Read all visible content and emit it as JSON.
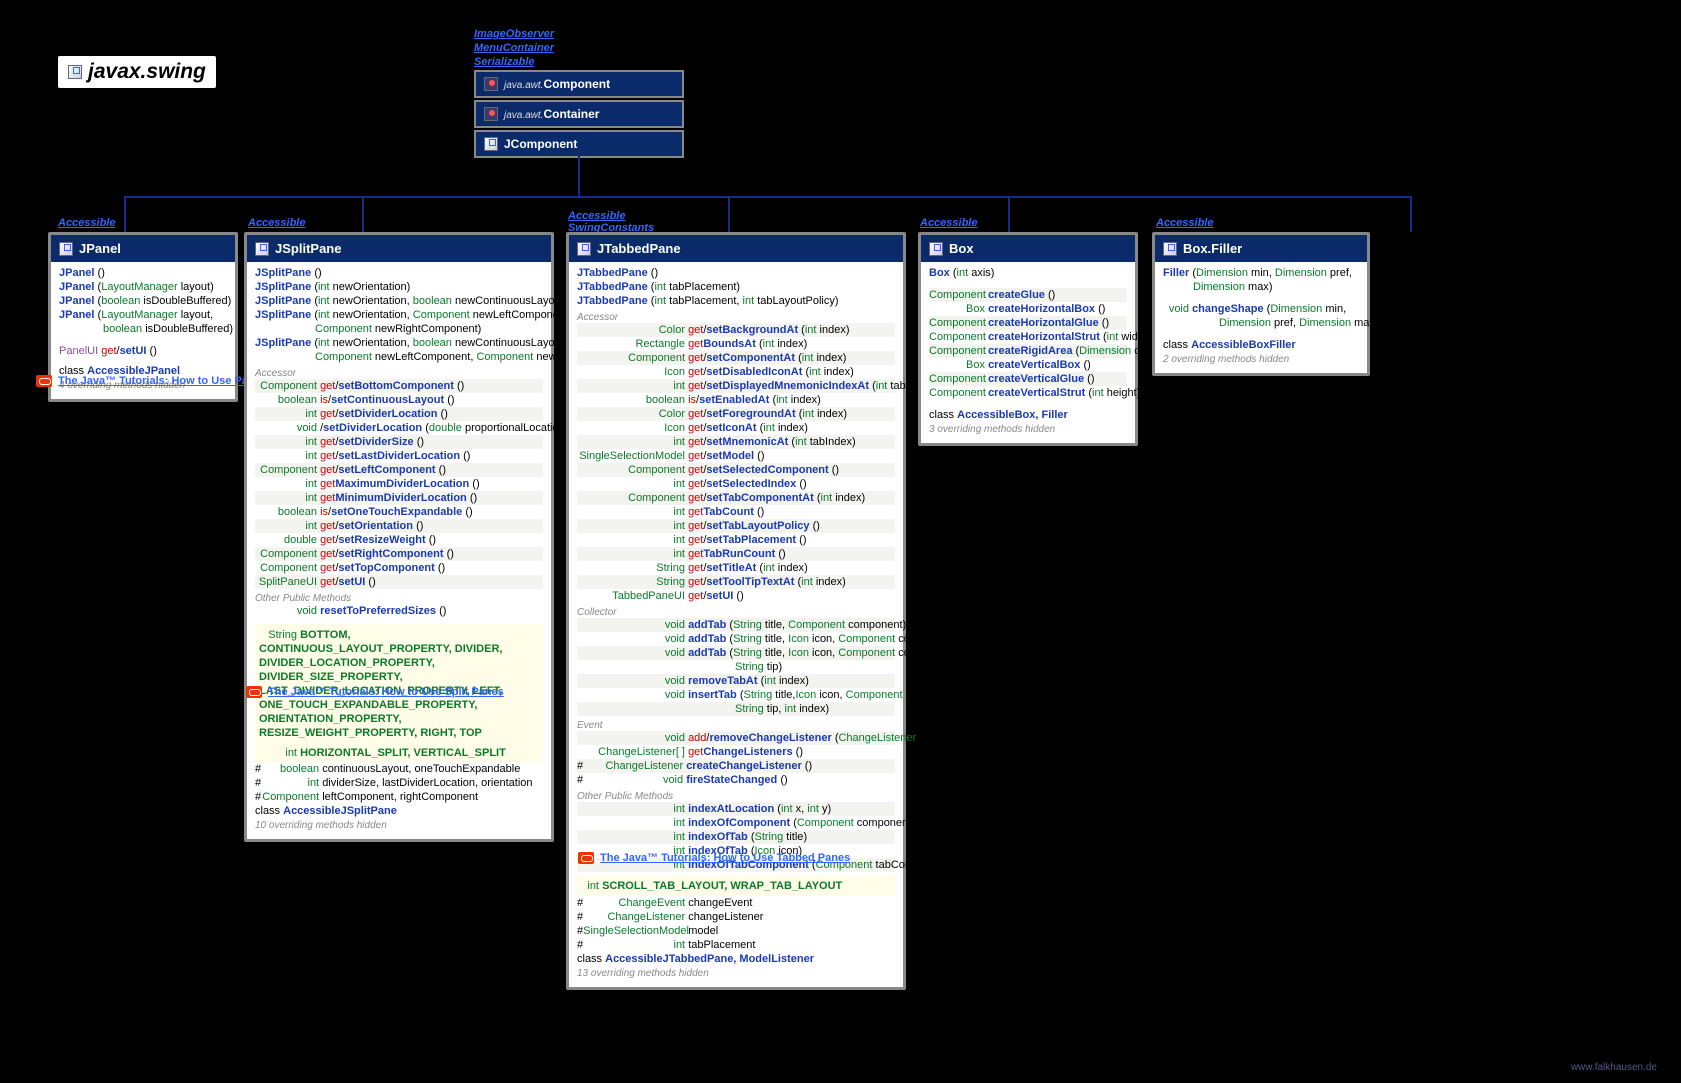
{
  "package": "javax.swing",
  "interfaces_top": [
    "ImageObserver",
    "MenuContainer",
    "Serializable"
  ],
  "roots": [
    {
      "pkg": "java.awt.",
      "name": "Component"
    },
    {
      "pkg": "java.awt.",
      "name": "Container"
    },
    {
      "pkg": "",
      "name": "JComponent"
    }
  ],
  "iface_accessible": "Accessible",
  "iface_swingconstants": "SwingConstants",
  "footer": "www.falkhausen.de",
  "tutorials": {
    "panels": "The Java™ Tutorials: How to Use Panels",
    "splitpanes": "The Java™ Tutorials: How to Use Split Panes",
    "tabbedpanes": "The Java™ Tutorials: How to Use Tabbed Panes"
  },
  "jpanel": {
    "name": "JPanel",
    "ctors": [
      {
        "name": "JPanel",
        "sig": "()"
      },
      {
        "name": "JPanel",
        "sig": "(LayoutManager layout)"
      },
      {
        "name": "JPanel",
        "sig": "(boolean isDoubleBuffered)"
      },
      {
        "name": "JPanel",
        "sig": "(LayoutManager layout,",
        "cont": "boolean isDoubleBuffered)"
      }
    ],
    "ui_ret": "PanelUI",
    "ui_get": "get",
    "ui_set": "setUI",
    "ui_sig": "()",
    "inner_kw": "class",
    "inner": "AccessibleJPanel",
    "hidden": "4 overriding methods hidden"
  },
  "jsplitpane": {
    "name": "JSplitPane",
    "ctors": [
      {
        "name": "JSplitPane",
        "sig": "()"
      },
      {
        "name": "JSplitPane",
        "sig": "(int newOrientation)"
      },
      {
        "name": "JSplitPane",
        "sig": "(int newOrientation, boolean newContinuousLayout)"
      },
      {
        "name": "JSplitPane",
        "sig": "(int newOrientation, Component newLeftComponent,",
        "cont": "Component newRightComponent)"
      },
      {
        "name": "JSplitPane",
        "sig": "(int newOrientation, boolean newContinuousLayout,",
        "cont": "Component newLeftComponent, Component newRightComponent)"
      }
    ],
    "sec_accessor": "Accessor",
    "accessors": [
      {
        "ret": "Component",
        "get": "get",
        "set": "setBottomComponent",
        "sig": "()"
      },
      {
        "ret": "boolean",
        "get": "is",
        "set": "setContinuousLayout",
        "sig": "()"
      },
      {
        "ret": "int",
        "get": "get",
        "set": "setDividerLocation",
        "sig": "()"
      },
      {
        "ret": "void",
        "get": "",
        "set": "setDividerLocation",
        "sig": "(double proportionalLocation)"
      },
      {
        "ret": "int",
        "get": "get",
        "set": "setDividerSize",
        "sig": "()"
      },
      {
        "ret": "int",
        "get": "get",
        "set": "setLastDividerLocation",
        "sig": "()"
      },
      {
        "ret": "Component",
        "get": "get",
        "set": "setLeftComponent",
        "sig": "()"
      },
      {
        "ret": "int",
        "get": "get",
        "set": "MaximumDividerLocation",
        "sig": "()",
        "getonly": true
      },
      {
        "ret": "int",
        "get": "get",
        "set": "MinimumDividerLocation",
        "sig": "()",
        "getonly": true
      },
      {
        "ret": "boolean",
        "get": "is",
        "set": "setOneTouchExpandable",
        "sig": "()"
      },
      {
        "ret": "int",
        "get": "get",
        "set": "setOrientation",
        "sig": "()"
      },
      {
        "ret": "double",
        "get": "get",
        "set": "setResizeWeight",
        "sig": "()"
      },
      {
        "ret": "Component",
        "get": "get",
        "set": "setRightComponent",
        "sig": "()"
      },
      {
        "ret": "Component",
        "get": "get",
        "set": "setTopComponent",
        "sig": "()"
      },
      {
        "ret": "SplitPaneUI",
        "get": "get",
        "set": "setUI",
        "sig": "()"
      }
    ],
    "sec_other": "Other Public Methods",
    "other": [
      {
        "ret": "void",
        "name": "resetToPreferredSizes",
        "sig": "()"
      }
    ],
    "const_ret": "String",
    "const_str": "BOTTOM, CONTINUOUS_LAYOUT_PROPERTY, DIVIDER, DIVIDER_LOCATION_PROPERTY, DIVIDER_SIZE_PROPERTY, LAST_DIVIDER_LOCATION_PROPERTY, LEFT, ONE_TOUCH_EXPANDABLE_PROPERTY, ORIENTATION_PROPERTY, RESIZE_WEIGHT_PROPERTY, RIGHT, TOP",
    "const_int_ret": "int",
    "const_int": "HORIZONTAL_SPLIT, VERTICAL_SPLIT",
    "fields": [
      {
        "mod": "#",
        "ret": "boolean",
        "name": "continuousLayout, oneTouchExpandable"
      },
      {
        "mod": "#",
        "ret": "int",
        "name": "dividerSize, lastDividerLocation, orientation"
      },
      {
        "mod": "#",
        "ret": "Component",
        "name": "leftComponent, rightComponent"
      }
    ],
    "inner_kw": "class",
    "inner": "AccessibleJSplitPane",
    "hidden": "10 overriding methods hidden"
  },
  "jtabbedpane": {
    "name": "JTabbedPane",
    "ctors": [
      {
        "name": "JTabbedPane",
        "sig": "()"
      },
      {
        "name": "JTabbedPane",
        "sig": "(int tabPlacement)"
      },
      {
        "name": "JTabbedPane",
        "sig": "(int tabPlacement, int tabLayoutPolicy)"
      }
    ],
    "sec_accessor": "Accessor",
    "accessors": [
      {
        "ret": "Color",
        "get": "get",
        "set": "setBackgroundAt",
        "sig": "(int index)"
      },
      {
        "ret": "Rectangle",
        "get": "get",
        "set": "BoundsAt",
        "sig": "(int index)",
        "getonly": true
      },
      {
        "ret": "Component",
        "get": "get",
        "set": "setComponentAt",
        "sig": "(int index)"
      },
      {
        "ret": "Icon",
        "get": "get",
        "set": "setDisabledIconAt",
        "sig": "(int index)"
      },
      {
        "ret": "int",
        "get": "get",
        "set": "setDisplayedMnemonicIndexAt",
        "sig": "(int tabIndex)"
      },
      {
        "ret": "boolean",
        "get": "is",
        "set": "setEnabledAt",
        "sig": "(int index)"
      },
      {
        "ret": "Color",
        "get": "get",
        "set": "setForegroundAt",
        "sig": "(int index)"
      },
      {
        "ret": "Icon",
        "get": "get",
        "set": "setIconAt",
        "sig": "(int index)"
      },
      {
        "ret": "int",
        "get": "get",
        "set": "setMnemonicAt",
        "sig": "(int tabIndex)"
      },
      {
        "ret": "SingleSelectionModel",
        "get": "get",
        "set": "setModel",
        "sig": "()"
      },
      {
        "ret": "Component",
        "get": "get",
        "set": "setSelectedComponent",
        "sig": "()"
      },
      {
        "ret": "int",
        "get": "get",
        "set": "setSelectedIndex",
        "sig": "()"
      },
      {
        "ret": "Component",
        "get": "get",
        "set": "setTabComponentAt",
        "sig": "(int index)"
      },
      {
        "ret": "int",
        "get": "get",
        "set": "TabCount",
        "sig": "()",
        "getonly": true
      },
      {
        "ret": "int",
        "get": "get",
        "set": "setTabLayoutPolicy",
        "sig": "()"
      },
      {
        "ret": "int",
        "get": "get",
        "set": "setTabPlacement",
        "sig": "()"
      },
      {
        "ret": "int",
        "get": "get",
        "set": "TabRunCount",
        "sig": "()",
        "getonly": true
      },
      {
        "ret": "String",
        "get": "get",
        "set": "setTitleAt",
        "sig": "(int index)"
      },
      {
        "ret": "String",
        "get": "get",
        "set": "setToolTipTextAt",
        "sig": "(int index)"
      },
      {
        "ret": "TabbedPaneUI",
        "get": "get",
        "set": "setUI",
        "sig": "()"
      }
    ],
    "sec_collector": "Collector",
    "collector": [
      {
        "ret": "void",
        "name": "addTab",
        "sig_html": "(<span class='kw-param'>String</span> title, <span class='kw-param'>Component</span> component)"
      },
      {
        "ret": "void",
        "name": "addTab",
        "sig_html": "(<span class='kw-param'>String</span> title, <span class='kw-param'>Icon</span> icon, <span class='kw-param'>Component</span> component)"
      },
      {
        "ret": "void",
        "name": "addTab",
        "sig_html": "(<span class='kw-param'>String</span> title, <span class='kw-param'>Icon</span> icon, <span class='kw-param'>Component</span> component,",
        "cont": "String tip)"
      },
      {
        "ret": "void",
        "name": "removeTabAt",
        "sig_html": "(<span class='kw-param'>int</span> index)"
      },
      {
        "ret": "void",
        "name": "insertTab",
        "sig_html": "(<span class='kw-param'>String</span> title,<span class='kw-param'>Icon</span> icon, <span class='kw-param'>Component</span> component,",
        "cont": "String tip, int index)"
      }
    ],
    "sec_event": "Event",
    "event": [
      {
        "ret": "void",
        "get": "add",
        "set": "removeChangeListener",
        "sig": "(ChangeListener l)"
      },
      {
        "ret": "ChangeListener[ ]",
        "name": "getChangeListeners",
        "sig": "()",
        "getlike": true
      },
      {
        "mod": "#",
        "ret": "ChangeListener",
        "name": "createChangeListener",
        "sig": "()"
      },
      {
        "mod": "#",
        "ret": "void",
        "name": "fireStateChanged",
        "sig": "()"
      }
    ],
    "sec_other": "Other Public Methods",
    "other": [
      {
        "ret": "int",
        "name": "indexAtLocation",
        "sig": "(int x, int y)"
      },
      {
        "ret": "int",
        "name": "indexOfComponent",
        "sig": "(Component component)"
      },
      {
        "ret": "int",
        "name": "indexOfTab",
        "sig": "(String title)"
      },
      {
        "ret": "int",
        "name": "indexOfTab",
        "sig": "(Icon icon)"
      },
      {
        "ret": "int",
        "name": "indexOfTabComponent",
        "sig": "(Component tabComponent)"
      }
    ],
    "const_int_ret": "int",
    "const_int": "SCROLL_TAB_LAYOUT, WRAP_TAB_LAYOUT",
    "fields": [
      {
        "mod": "#",
        "ret": "ChangeEvent",
        "name": "changeEvent"
      },
      {
        "mod": "#",
        "ret": "ChangeListener",
        "name": "changeListener"
      },
      {
        "mod": "#",
        "ret": "SingleSelectionModel",
        "name": "model"
      },
      {
        "mod": "#",
        "ret": "int",
        "name": "tabPlacement"
      }
    ],
    "inner_kw": "class",
    "inner": "AccessibleJTabbedPane, ModelListener",
    "hidden": "13 overriding methods hidden"
  },
  "box": {
    "name": "Box",
    "ctors": [
      {
        "name": "Box",
        "sig": "(int axis)"
      }
    ],
    "statics": [
      {
        "ret": "Component",
        "name": "createGlue",
        "sig": "()"
      },
      {
        "ret": "Box",
        "name": "createHorizontalBox",
        "sig": "()"
      },
      {
        "ret": "Component",
        "name": "createHorizontalGlue",
        "sig": "()"
      },
      {
        "ret": "Component",
        "name": "createHorizontalStrut",
        "sig": "(int width)"
      },
      {
        "ret": "Component",
        "name": "createRigidArea",
        "sig": "(Dimension d)"
      },
      {
        "ret": "Box",
        "name": "createVerticalBox",
        "sig": "()"
      },
      {
        "ret": "Component",
        "name": "createVerticalGlue",
        "sig": "()"
      },
      {
        "ret": "Component",
        "name": "createVerticalStrut",
        "sig": "(int height)"
      }
    ],
    "inner_kw": "class",
    "inner": "AccessibleBox, Filler",
    "hidden": "3 overriding methods hidden"
  },
  "boxfiller": {
    "name": "Box.Filler",
    "ctors": [
      {
        "name": "Filler",
        "sig": "(Dimension min, Dimension pref,",
        "cont": "Dimension max)"
      }
    ],
    "methods": [
      {
        "ret": "void",
        "name": "changeShape",
        "sig": "(Dimension min,",
        "cont": "Dimension pref, Dimension max)"
      }
    ],
    "inner_kw": "class",
    "inner": "AccessibleBoxFiller",
    "hidden": "2 overriding methods hidden"
  }
}
